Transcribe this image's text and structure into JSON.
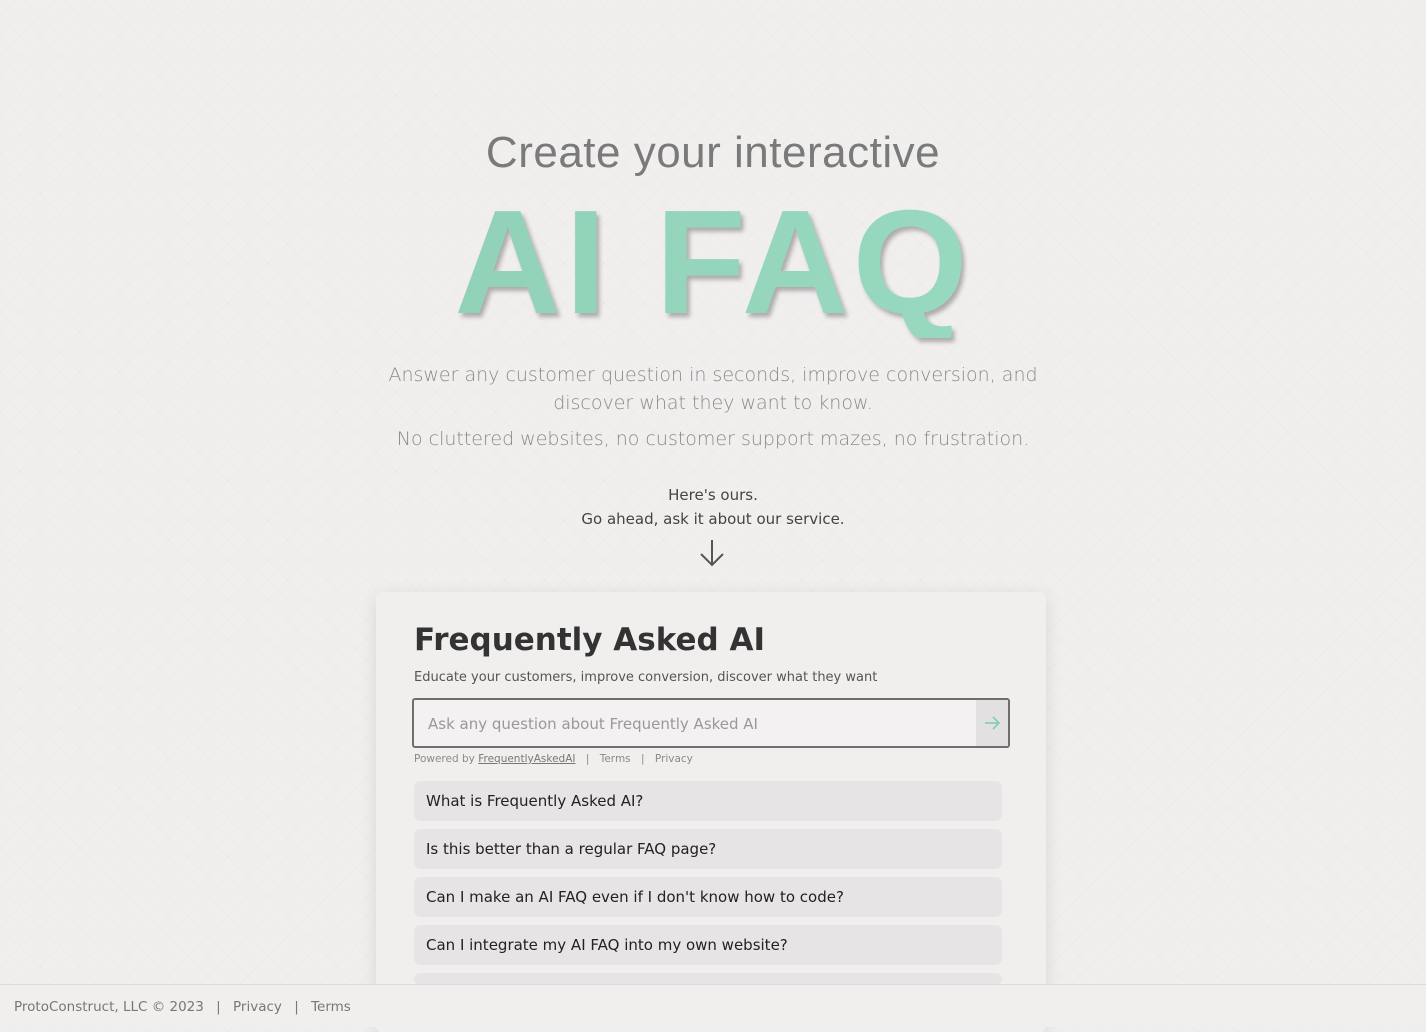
{
  "hero": {
    "subtitle": "Create your interactive",
    "title": "AI FAQ",
    "tagline_1": "Answer any customer question in seconds, improve conversion, and discover what they want to know.",
    "tagline_2": "No cluttered websites, no customer support mazes, no frustration.",
    "prompt_1": "Here's ours.",
    "prompt_2": "Go ahead, ask it about our service."
  },
  "card": {
    "title": "Frequently Asked AI",
    "subtitle": "Educate your customers, improve conversion, discover what they want",
    "search_placeholder": "Ask any question about Frequently Asked AI",
    "search_value": "",
    "powered_prefix": "Powered by",
    "powered_link": "FrequentlyAskedAI",
    "separator": "|",
    "terms_link": "Terms",
    "privacy_link": "Privacy",
    "questions": [
      "What is Frequently Asked AI?",
      "Is this better than a regular FAQ page?",
      "Can I make an AI FAQ even if I don't know how to code?",
      "Can I integrate my AI FAQ into my own website?"
    ]
  },
  "footer": {
    "copyright": "ProtoConstruct, LLC © 2023",
    "separator": "|",
    "privacy": "Privacy",
    "terms": "Terms"
  },
  "colors": {
    "background": "#f1eeee",
    "accent": "#96d9bf",
    "arrow_accent": "#7fcfb0"
  },
  "icons": {
    "scroll_hint": "arrow-down-icon",
    "submit": "arrow-right-icon"
  }
}
